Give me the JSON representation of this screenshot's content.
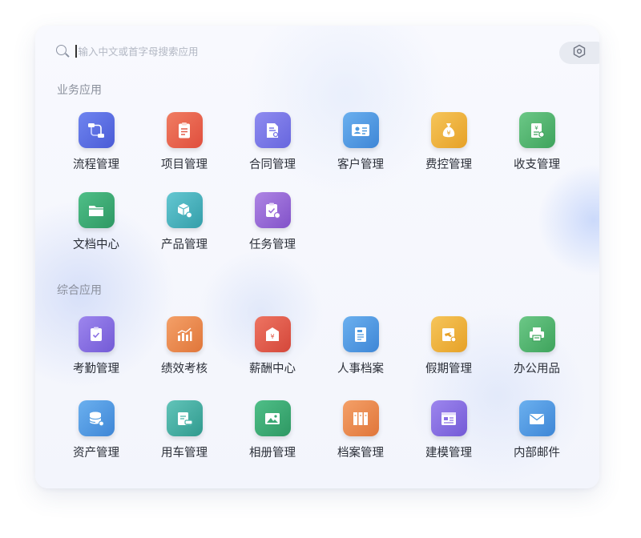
{
  "search": {
    "placeholder": "输入中文或首字母搜索应用",
    "icon": "search-icon"
  },
  "settings_icon": "settings-hexagon-icon",
  "sections": [
    {
      "title": "业务应用",
      "apps": [
        {
          "label": "流程管理",
          "icon": "workflow-icon",
          "color": "#5b6fe0"
        },
        {
          "label": "项目管理",
          "icon": "clipboard-list-icon",
          "color": "#e8634f"
        },
        {
          "label": "合同管理",
          "icon": "contract-document-icon",
          "color": "#7a78e8"
        },
        {
          "label": "客户管理",
          "icon": "customer-card-icon",
          "color": "#4f9be0"
        },
        {
          "label": "费控管理",
          "icon": "money-bag-icon",
          "color": "#efb33a"
        },
        {
          "label": "收支管理",
          "icon": "finance-ledger-icon",
          "color": "#4fb56a"
        },
        {
          "label": "文档中心",
          "icon": "folder-icon",
          "color": "#3aa874"
        },
        {
          "label": "产品管理",
          "icon": "product-box-icon",
          "color": "#49b3bf"
        },
        {
          "label": "任务管理",
          "icon": "task-clipboard-icon",
          "color": "#9b6cd8"
        }
      ]
    },
    {
      "title": "综合应用",
      "apps": [
        {
          "label": "考勤管理",
          "icon": "attendance-clipboard-icon",
          "color": "#8a6fe4"
        },
        {
          "label": "绩效考核",
          "icon": "performance-chart-icon",
          "color": "#ef8b4d"
        },
        {
          "label": "薪酬中心",
          "icon": "salary-envelope-icon",
          "color": "#e25a48"
        },
        {
          "label": "人事档案",
          "icon": "hr-record-icon",
          "color": "#4f9be0"
        },
        {
          "label": "假期管理",
          "icon": "vacation-plane-icon",
          "color": "#efb33a"
        },
        {
          "label": "办公用品",
          "icon": "printer-icon",
          "color": "#4fb56a"
        },
        {
          "label": "资产管理",
          "icon": "asset-database-icon",
          "color": "#4f9be0"
        },
        {
          "label": "用车管理",
          "icon": "vehicle-clipboard-icon",
          "color": "#49b3a8"
        },
        {
          "label": "相册管理",
          "icon": "photo-album-icon",
          "color": "#3aa874"
        },
        {
          "label": "档案管理",
          "icon": "archive-binders-icon",
          "color": "#e88a4f"
        },
        {
          "label": "建模管理",
          "icon": "modeling-window-icon",
          "color": "#8a6fe4"
        },
        {
          "label": "内部邮件",
          "icon": "mail-envelope-icon",
          "color": "#4f9be0"
        }
      ]
    }
  ]
}
